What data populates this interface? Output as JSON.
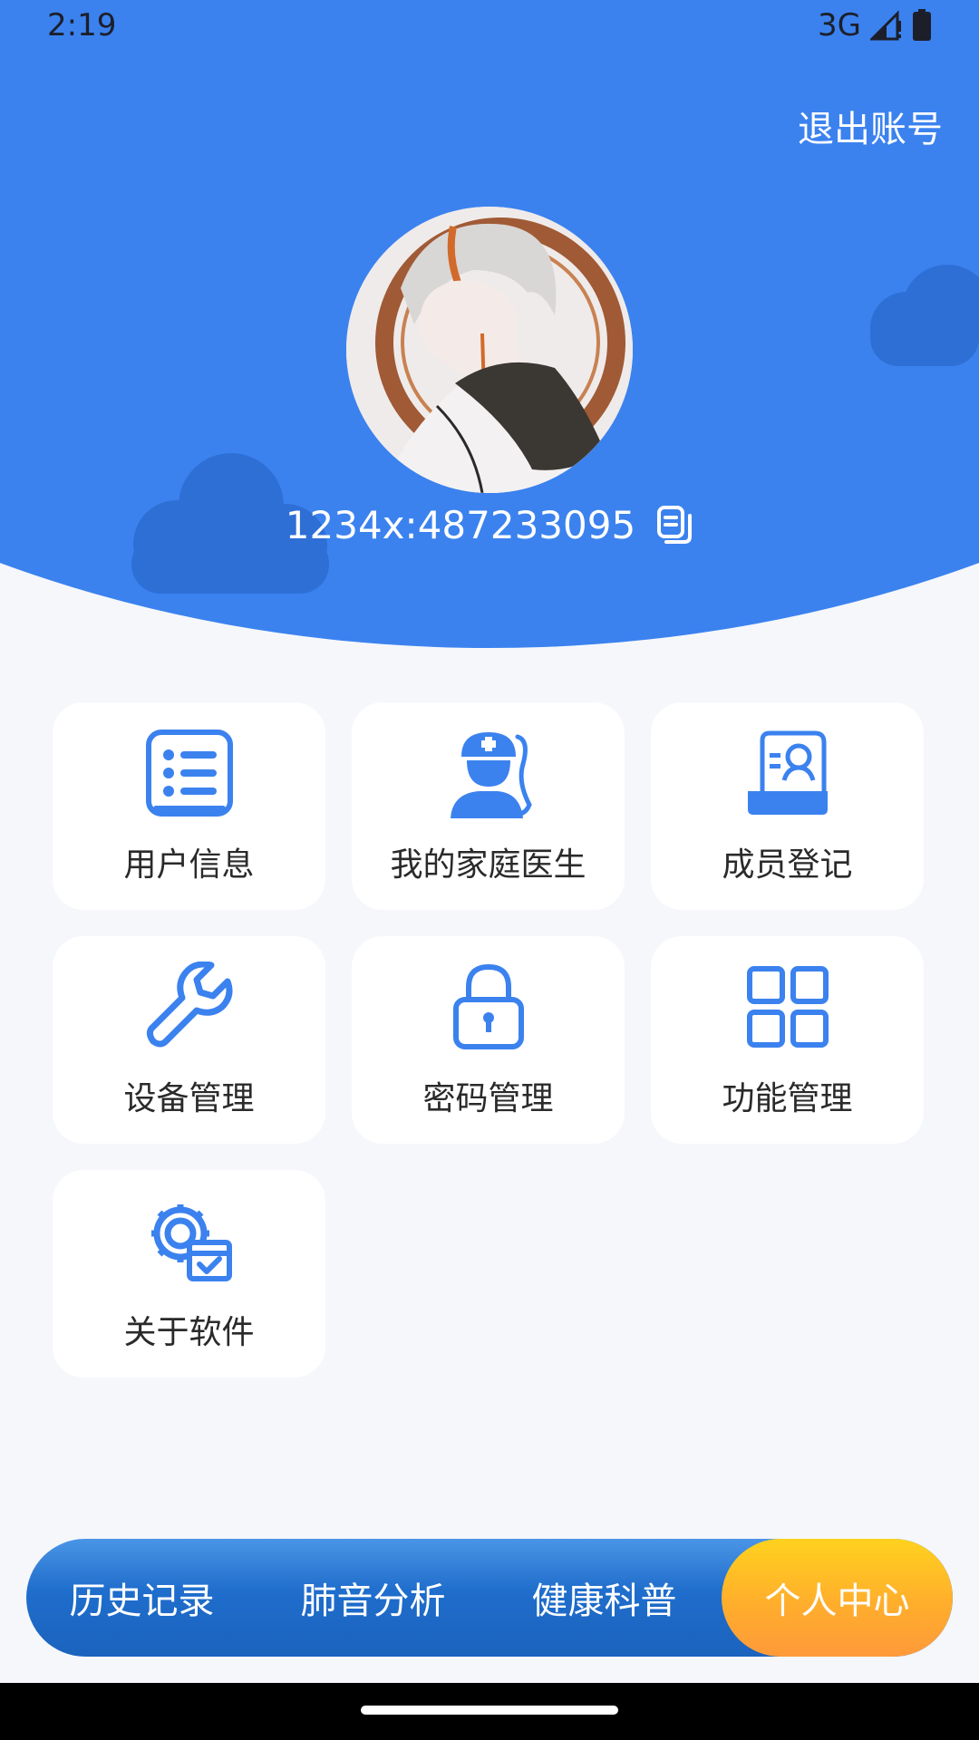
{
  "status": {
    "time": "2:19",
    "network": "3G"
  },
  "header": {
    "logout": "退出账号",
    "user_id": "1234x:487233095"
  },
  "grid": {
    "items": [
      {
        "label": "用户信息",
        "icon": "list-icon"
      },
      {
        "label": "我的家庭医生",
        "icon": "doctor-icon"
      },
      {
        "label": "成员登记",
        "icon": "member-register-icon"
      },
      {
        "label": "设备管理",
        "icon": "wrench-icon"
      },
      {
        "label": "密码管理",
        "icon": "lock-icon"
      },
      {
        "label": "功能管理",
        "icon": "grid-icon"
      },
      {
        "label": "关于软件",
        "icon": "gear-check-icon"
      }
    ]
  },
  "nav": {
    "items": [
      {
        "label": "历史记录"
      },
      {
        "label": "肺音分析"
      },
      {
        "label": "健康科普"
      },
      {
        "label": "个人中心",
        "active": true
      }
    ]
  },
  "colors": {
    "accent": "#3b82ef",
    "active_tab": "#ffb52a",
    "nav": "#1f6dcc"
  }
}
